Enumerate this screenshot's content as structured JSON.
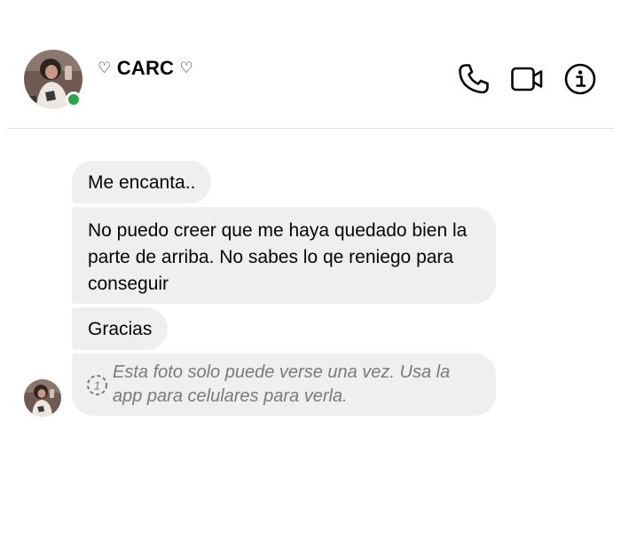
{
  "header": {
    "contact_name": "CARC",
    "name_decoration": "♡",
    "online_status_color": "#31a24c",
    "actions": [
      {
        "name": "phone-call-button",
        "icon": "phone-icon"
      },
      {
        "name": "video-call-button",
        "icon": "video-camera-icon"
      },
      {
        "name": "info-button",
        "icon": "info-icon"
      }
    ]
  },
  "messages": [
    {
      "text": "Me encanta.."
    },
    {
      "text": "No puedo creer que me haya quedado bien la parte de arriba. No sabes lo qe reniego para conseguir"
    },
    {
      "text": "Gracias"
    },
    {
      "text": "Esta foto solo puede verse una vez. Usa la app para celulares para verla.",
      "type": "view-once-photo",
      "icon": "view-once-icon",
      "icon_label": "1"
    }
  ],
  "colors": {
    "bubble": "#efefef",
    "text": "#050505",
    "muted_text": "#7a7a7a",
    "divider": "#dedede"
  }
}
